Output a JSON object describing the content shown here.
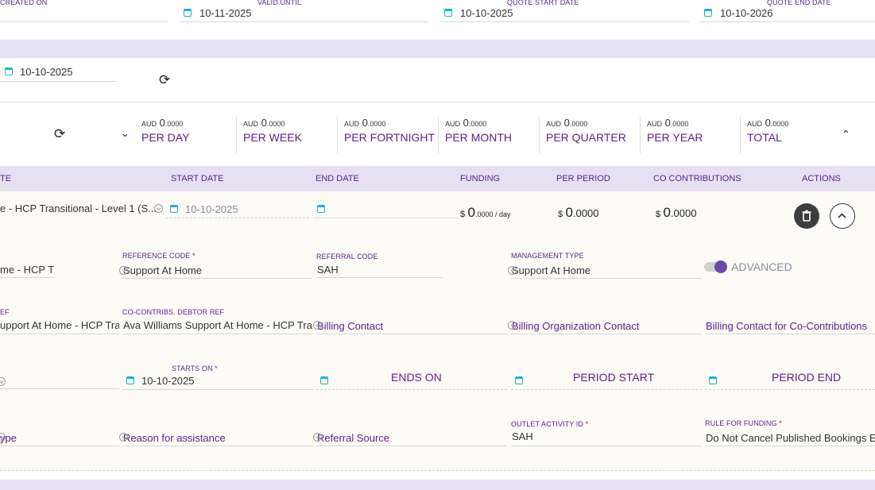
{
  "top_dates": {
    "created_on_label": "CREATED ON",
    "valid_until_label": "VALID UNTIL",
    "valid_until_value": "10-11-2025",
    "quote_start_label": "QUOTE START DATE",
    "quote_start_value": "10-10-2025",
    "quote_end_label": "QUOTE END DATE",
    "quote_end_value": "10-10-2026"
  },
  "recalc_row": {
    "date_value": "10-10-2025"
  },
  "summary": {
    "currency": "AUD",
    "items": [
      {
        "amount": "0",
        "decimals": ".0000",
        "period": "PER DAY"
      },
      {
        "amount": "0",
        "decimals": ".0000",
        "period": "PER WEEK"
      },
      {
        "amount": "0",
        "decimals": ".0000",
        "period": "PER FORTNIGHT"
      },
      {
        "amount": "0",
        "decimals": ".0000",
        "period": "PER MONTH"
      },
      {
        "amount": "0",
        "decimals": ".0000",
        "period": "PER QUARTER"
      },
      {
        "amount": "0",
        "decimals": ".0000",
        "period": "PER YEAR"
      },
      {
        "amount": "0",
        "decimals": ".0000",
        "period": "TOTAL"
      }
    ]
  },
  "table": {
    "headers": {
      "rate": "TE",
      "start_date": "START DATE",
      "end_date": "END DATE",
      "funding": "FUNDING",
      "per_period": "PER PERIOD",
      "co_contributions": "CO CONTRIBUTIONS",
      "actions": "ACTIONS"
    },
    "row": {
      "rate_name": "e - HCP Transitional - Level 1 (S...",
      "start_date": "10-10-2025",
      "funding_currency": "$",
      "funding_int": "0",
      "funding_dec": ".0000 / day",
      "per_period_currency": "$",
      "per_period_int": "0",
      "per_period_dec": ".0000",
      "co_currency": "$",
      "co_int": "0",
      "co_dec": ".0000"
    }
  },
  "details": {
    "name_value": "me - HCP Tr",
    "reference_code_label": "REFERENCE CODE *",
    "reference_code_value": "Support At Home",
    "referral_code_label": "REFERRAL CODE",
    "referral_code_value": "SAH",
    "management_type_label": "MANAGEMENT TYPE",
    "management_type_value": "Support At Home",
    "advanced_label": "ADVANCED",
    "debtor_ref_label": "EF",
    "debtor_ref_value": "upport At Home - HCP Tra",
    "co_debtor_label": "CO-CONTRIBS. DEBTOR REF",
    "co_debtor_value": "Ava Williams Support At Home - HCP Tra",
    "billing_contact": "Billing Contact",
    "billing_org_contact": "Billing Organization Contact",
    "billing_co_contact": "Billing Contact for Co-Contributions",
    "starts_on_label": "STARTS ON *",
    "starts_on_value": "10-10-2025",
    "ends_on": "ENDS ON",
    "period_start": "PERIOD START",
    "period_end": "PERIOD END",
    "type_placeholder": "ype",
    "reason": "Reason for assistance",
    "referral_source": "Referral Source",
    "outlet_label": "OUTLET ACTIVITY ID *",
    "outlet_value": "SAH",
    "rule_label": "RULE FOR FUNDING *",
    "rule_value": "Do Not Cancel Published Bookings E"
  },
  "colors": {
    "accent": "#5b1f8a",
    "band": "#e6e1f2",
    "calendar": "#1ab3d1"
  }
}
